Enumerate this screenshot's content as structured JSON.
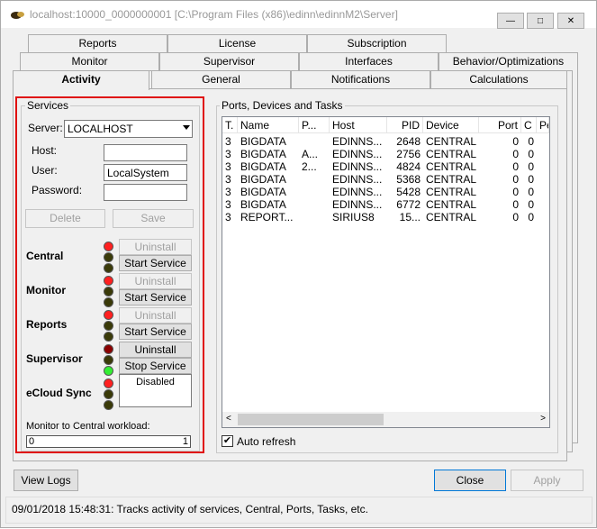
{
  "window": {
    "title": "localhost:10000_0000000001 [C:\\Program Files (x86)\\edinn\\edinnM2\\Server]",
    "minimize": "—",
    "maximize": "□",
    "close": "✕"
  },
  "tabs": {
    "row1": [
      "Reports",
      "License",
      "Subscription"
    ],
    "row2": [
      "Monitor",
      "Supervisor",
      "Interfaces",
      "Behavior/Optimizations"
    ],
    "row3": [
      "Activity",
      "General",
      "Notifications",
      "Calculations"
    ],
    "active": "Activity"
  },
  "services": {
    "group_label": "Services",
    "server_label": "Server:",
    "server_value": "LOCALHOST",
    "host_label": "Host:",
    "host_value": "",
    "user_label": "User:",
    "user_value": "LocalSystem",
    "password_label": "Password:",
    "password_value": "",
    "delete_label": "Delete",
    "save_label": "Save",
    "items": [
      {
        "name": "Central",
        "top_button": "Uninstall",
        "bottom_button": "Start Service",
        "lights": [
          "red",
          "olive",
          "olive"
        ]
      },
      {
        "name": "Monitor",
        "top_button": "Uninstall",
        "bottom_button": "Start Service",
        "lights": [
          "red",
          "olive",
          "olive"
        ]
      },
      {
        "name": "Reports",
        "top_button": "Uninstall",
        "bottom_button": "Start Service",
        "lights": [
          "red",
          "olive",
          "olive"
        ]
      },
      {
        "name": "Supervisor",
        "top_button": "Uninstall",
        "bottom_button": "Stop Service",
        "lights": [
          "darkred",
          "olive",
          "green"
        ]
      },
      {
        "name": "eCloud Sync",
        "status_text": "Disabled",
        "lights": [
          "red",
          "olive",
          "olive"
        ]
      }
    ],
    "workload_label": "Monitor to Central workload:",
    "workload_min": "0",
    "workload_max": "1",
    "workload_value": 0
  },
  "ports": {
    "group_label": "Ports, Devices and Tasks",
    "columns": [
      "T.",
      "Name",
      "P...",
      "Host",
      "PID",
      "Device",
      "Port",
      "C",
      "Pe"
    ],
    "rows": [
      [
        "3",
        "BIGDATA",
        "",
        "EDINNS...",
        "2648",
        "CENTRAL",
        "0",
        "0",
        ""
      ],
      [
        "3",
        "BIGDATA",
        "A...",
        "EDINNS...",
        "2756",
        "CENTRAL",
        "0",
        "0",
        ""
      ],
      [
        "3",
        "BIGDATA",
        "2...",
        "EDINNS...",
        "4824",
        "CENTRAL",
        "0",
        "0",
        ""
      ],
      [
        "3",
        "BIGDATA",
        "",
        "EDINNS...",
        "5368",
        "CENTRAL",
        "0",
        "0",
        ""
      ],
      [
        "3",
        "BIGDATA",
        "",
        "EDINNS...",
        "5428",
        "CENTRAL",
        "0",
        "0",
        ""
      ],
      [
        "3",
        "BIGDATA",
        "",
        "EDINNS...",
        "6772",
        "CENTRAL",
        "0",
        "0",
        ""
      ],
      [
        "3",
        "REPORT...",
        "",
        "SIRIUS8",
        "15...",
        "CENTRAL",
        "0",
        "0",
        ""
      ]
    ],
    "auto_refresh_label": "Auto refresh",
    "auto_refresh_checked": true
  },
  "footer": {
    "view_logs": "View Logs",
    "close": "Close",
    "apply": "Apply"
  },
  "status_bar": "09/01/2018 15:48:31: Tracks activity of services, Central, Ports, Tasks, etc.",
  "colors": {
    "highlight": "#e01010",
    "red": "#ff2020",
    "darkred": "#8b0000",
    "olive": "#3a3a08",
    "green": "#33ee33"
  }
}
